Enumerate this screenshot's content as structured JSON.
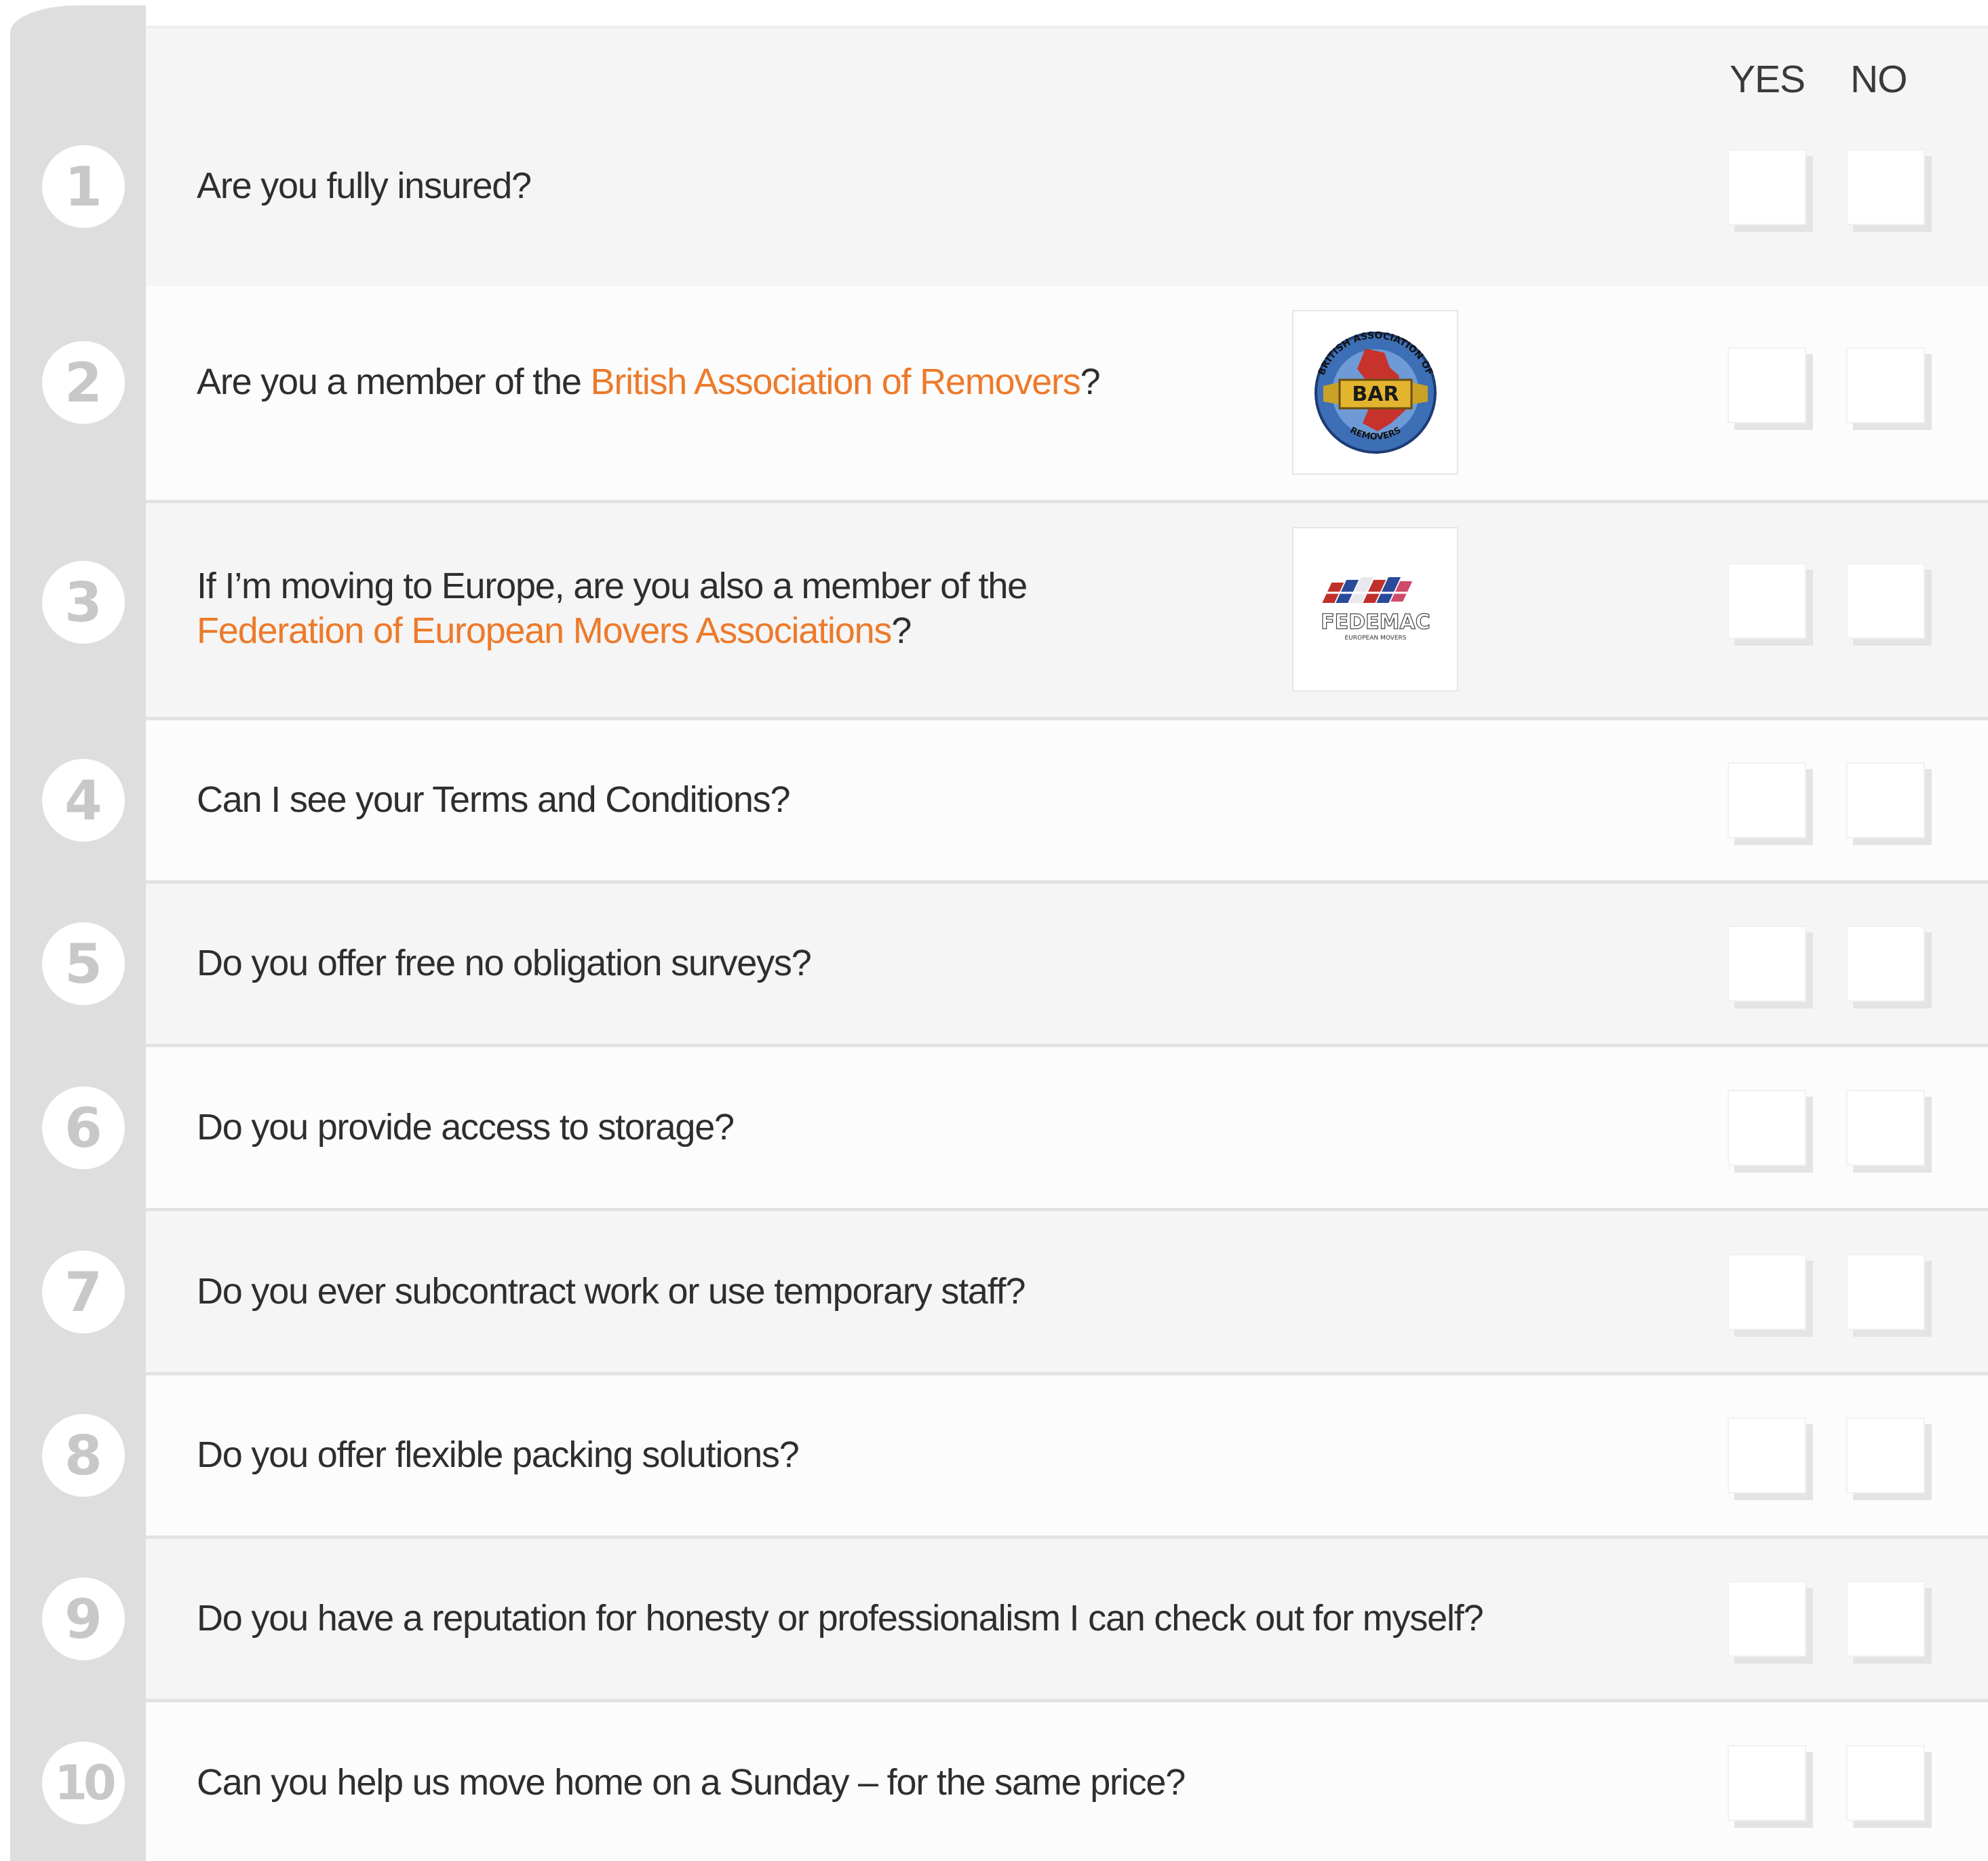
{
  "header": {
    "yes_label": "YES",
    "no_label": "NO"
  },
  "questions": [
    {
      "number": "1",
      "text": "Are you fully insured?"
    },
    {
      "number": "2",
      "text_before": "Are you a member of the ",
      "link": "British Association of Removers",
      "text_after": "?",
      "logo": "BAR",
      "logo_ring_text": "BRITISH ASSOCIATION OF REMOVERS",
      "logo_top_text": "BRITISH ASSOCIATION OF",
      "logo_bottom_text": "REMOVERS"
    },
    {
      "number": "3",
      "line1": "If I’m moving to Europe, are you also a member of the",
      "link": "Federation of European Movers Associations",
      "text_after": "?",
      "logo": "FEDEMAC",
      "logo_sub": "EUROPEAN MOVERS"
    },
    {
      "number": "4",
      "text": "Can I see your Terms and Conditions?"
    },
    {
      "number": "5",
      "text": "Do you offer free no obligation surveys?"
    },
    {
      "number": "6",
      "text": "Do you provide access to storage?"
    },
    {
      "number": "7",
      "text": "Do you ever subcontract work or use temporary staff?"
    },
    {
      "number": "8",
      "text": "Do you offer flexible packing solutions?"
    },
    {
      "number": "9",
      "text": "Do you have a reputation for honesty or professionalism I can check out for myself?"
    },
    {
      "number": "10",
      "text": "Can you help us move home on a Sunday – for the same price?"
    }
  ],
  "colors": {
    "accent": "#ed7a2b",
    "number_column": "#dedede",
    "row_shade": "#f5f5f5"
  }
}
